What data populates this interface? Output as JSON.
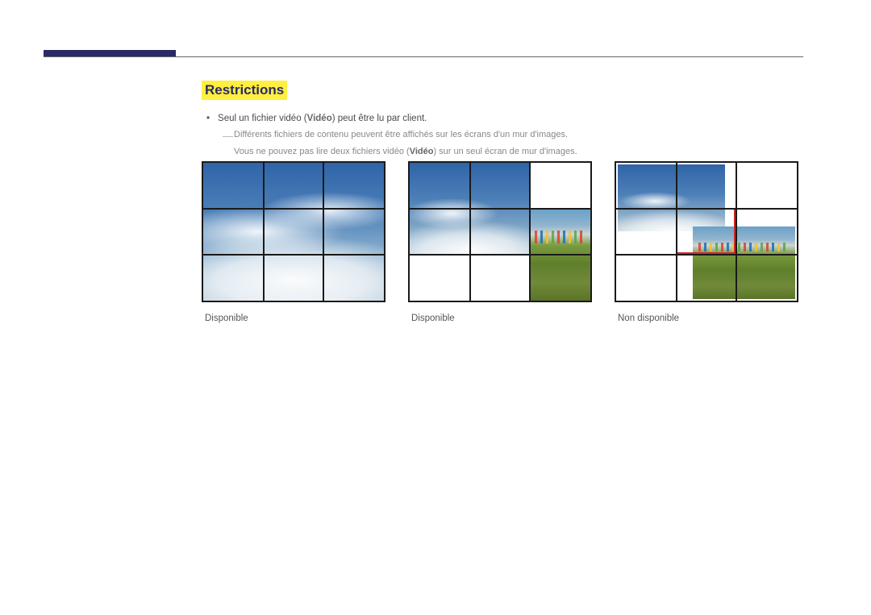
{
  "section": {
    "heading": "Restrictions"
  },
  "bullet": {
    "text_before": "Seul un fichier vidéo (",
    "keyword": "Vidéo",
    "text_after": ") peut être lu par client."
  },
  "sub": {
    "line1": "Différents fichiers de contenu peuvent être affichés sur les écrans d'un mur d'images.",
    "line2_before": "Vous ne pouvez pas lire deux fichiers vidéo (",
    "line2_keyword": "Vidéo",
    "line2_after": ") sur un seul écran de mur d'images."
  },
  "captions": {
    "fig1": "Disponible",
    "fig2": "Disponible",
    "fig3": "Non disponible"
  }
}
